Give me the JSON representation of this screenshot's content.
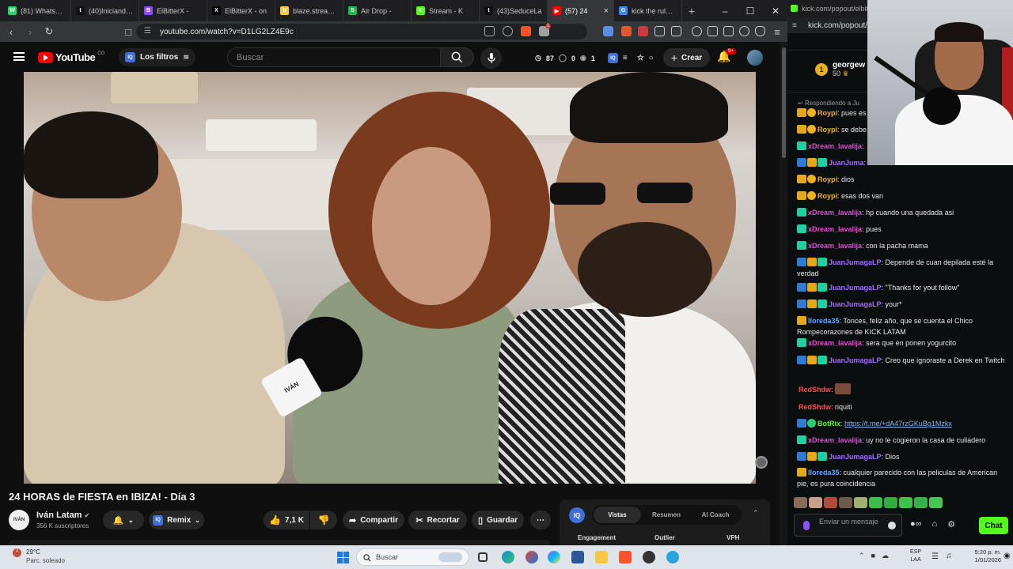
{
  "browser": {
    "tabs": [
      {
        "label": "(81) WhatsApp",
        "color": "#25d366",
        "glyph": "W"
      },
      {
        "label": "(40)Iniciando n",
        "color": "#111111",
        "glyph": "t"
      },
      {
        "label": "ElBitterX -",
        "color": "#9146ff",
        "glyph": "B"
      },
      {
        "label": "ElBitterX - on",
        "color": "#000000",
        "glyph": "X"
      },
      {
        "label": "blaze.stream/s",
        "color": "#f2c94c",
        "glyph": "b"
      },
      {
        "label": "Air Drop -",
        "color": "#1db954",
        "glyph": "S"
      },
      {
        "label": "Stream - K",
        "color": "#53fc18",
        "glyph": "K"
      },
      {
        "label": "(43)SeduceLa",
        "color": "#111111",
        "glyph": "t"
      },
      {
        "label": "(57) 24",
        "color": "#ff0000",
        "glyph": "▶"
      },
      {
        "label": "kick the rules t",
        "color": "#4285f4",
        "glyph": "G"
      }
    ],
    "new_tab": "+",
    "url": "youtube.com/watch?v=D1LG2LZ4E9c",
    "ext_badge": "1"
  },
  "youtube": {
    "logo": "YouTube",
    "country": "CO",
    "filters_label": "Los filtros",
    "search_placeholder": "Buscar",
    "stats": {
      "views": "87",
      "dislikes": "0",
      "eye": "1"
    },
    "create_label": "Crear",
    "notif_badge": "9+",
    "video_title": "24 HORAS de FIESTA en IBIZA! - Día 3",
    "channel_name": "Iván Latam",
    "channel_avatar": "IVÁN",
    "subscribers": "356 K suscriptores",
    "remix_label": "Remix",
    "likes": "7,1 K",
    "share_label": "Compartir",
    "clip_label": "Recortar",
    "save_label": "Guardar",
    "mic_sign": "IVÁN",
    "panel": {
      "tabs": [
        "Vistas",
        "Resumen",
        "AI Coach"
      ],
      "columns": [
        "Engagement",
        "Outlier",
        "VPH"
      ]
    }
  },
  "kick": {
    "tab_url": "kick.com/popout/elbitt",
    "url": "kick.com/popout/",
    "gift_user": "georgew",
    "gift_amount": "50",
    "gift_rank": "1",
    "replying": "Respondiendo a Ju",
    "messages": [
      {
        "badges": [
          "crown",
          "gift"
        ],
        "user": "Roypi",
        "color": "#f0b21e",
        "text": "pues es"
      },
      {
        "badges": [
          "crown",
          "gift"
        ],
        "user": "Roypi",
        "color": "#f0b21e",
        "text": "se debe"
      },
      {
        "badges": [
          "sub"
        ],
        "user": "xDream_lavalija",
        "color": "#e44bd3",
        "text": ""
      },
      {
        "badges": [
          "vip",
          "crown",
          "sub"
        ],
        "user": "JuanJuma",
        "color": "#a36bff",
        "text": ""
      },
      {
        "badges": [
          "crown",
          "gift"
        ],
        "user": "Roypi",
        "color": "#f0b21e",
        "text": "dios"
      },
      {
        "badges": [
          "crown",
          "gift"
        ],
        "user": "Roypi",
        "color": "#f0b21e",
        "text": "esas dos van"
      },
      {
        "badges": [
          "sub"
        ],
        "user": "xDream_lavalija",
        "color": "#e44bd3",
        "text": "hp cuando una quedada asi"
      },
      {
        "badges": [
          "sub"
        ],
        "user": "xDream_lavalija",
        "color": "#e44bd3",
        "text": "pues"
      },
      {
        "badges": [
          "sub"
        ],
        "user": "xDream_lavalija",
        "color": "#e44bd3",
        "text": "con la pacha mama"
      },
      {
        "badges": [
          "vip",
          "crown",
          "sub"
        ],
        "user": "JuanJumagaLP",
        "color": "#a36bff",
        "text": "Depende de cuan depilada esté la verdad"
      },
      {
        "badges": [
          "vip",
          "crown",
          "sub"
        ],
        "user": "JuanJumagaLP",
        "color": "#a36bff",
        "text": "\"Thanks for yout follow\""
      },
      {
        "badges": [
          "vip",
          "crown",
          "sub"
        ],
        "user": "JuanJumagaLP",
        "color": "#a36bff",
        "text": "your*"
      },
      {
        "badges": [
          "crown"
        ],
        "user": "lloreda35",
        "color": "#5fa8ff",
        "text": "Tonces, feliz año, que se cuenta el Chico Rompecorazones de KICK LATAM"
      },
      {
        "badges": [
          "sub"
        ],
        "user": "xDream_lavalija",
        "color": "#e44bd3",
        "text": "sera que en ponen yogurcito"
      },
      {
        "badges": [
          "vip",
          "crown",
          "sub"
        ],
        "user": "JuanJumagaLP",
        "color": "#a36bff",
        "text": "Creo que ignoraste a Derek en Twitch"
      },
      {
        "badges": [],
        "user": "RedShdw",
        "color": "#ff4d4d",
        "text": "",
        "emote": true
      },
      {
        "badges": [],
        "user": "RedShdw",
        "color": "#ff4d4d",
        "text": "riquiti"
      },
      {
        "badges": [
          "vip",
          "ver"
        ],
        "user": "BotRix",
        "color": "#53fc18",
        "text": "",
        "link": "https://t.me/+dA47rzGKuBg1Mzkx"
      },
      {
        "badges": [
          "sub"
        ],
        "user": "xDream_lavalija",
        "color": "#e44bd3",
        "text": "uy no le cogieron la casa de culiadero"
      },
      {
        "badges": [
          "vip",
          "crown",
          "sub"
        ],
        "user": "JuanJumagaLP",
        "color": "#a36bff",
        "text": "Dios"
      },
      {
        "badges": [
          "crown"
        ],
        "user": "lloreda35",
        "color": "#5fa8ff",
        "text": "cualquier parecido con las peliculas de American pie, es pura coincidencia"
      }
    ],
    "input_placeholder": "Enviar un mensaje",
    "chat_button": "Chat"
  },
  "taskbar": {
    "temp": "29°C",
    "weather": "Parc. soleado",
    "weather_badge": "2",
    "search": "Buscar",
    "lang_top": "ESP",
    "lang_bottom": "LAA",
    "time": "5:20 p. m.",
    "date": "1/01/2026"
  }
}
